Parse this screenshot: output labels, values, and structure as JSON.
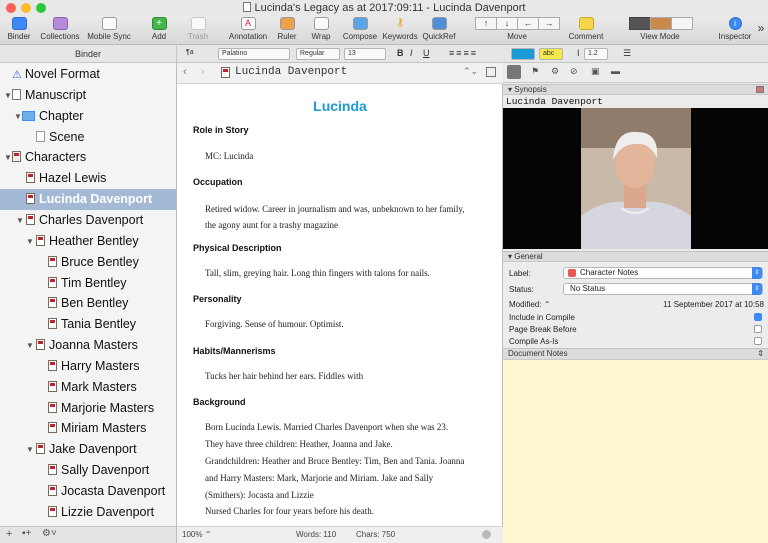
{
  "window": {
    "title": "Lucinda's Legacy as at 2017:09:11 - Lucinda Davenport"
  },
  "toolbar": {
    "binder": "Binder",
    "collections": "Collections",
    "mobile_sync": "Mobile Sync",
    "add": "Add",
    "trash": "Trash",
    "annotation": "Annotation",
    "ruler": "Ruler",
    "wrap": "Wrap",
    "compose": "Compose",
    "keywords": "Keywords",
    "quickref": "QuickRef",
    "move": "Move",
    "comment": "Comment",
    "view_mode": "View Mode",
    "inspector": "Inspector",
    "overflow": "»"
  },
  "formatbar": {
    "binder_label": "Binder",
    "style_icon": "¶a",
    "font": "Palatino",
    "weight": "Regular",
    "size": "13",
    "bold": "B",
    "italic": "I",
    "underline": "U",
    "highlight": "abc",
    "line_spacing": "1.2"
  },
  "binder": {
    "items": [
      {
        "label": "Novel Format",
        "icon": "warning-icon",
        "selected": false
      },
      {
        "label": "Manuscript",
        "icon": "manuscript-icon",
        "selected": false
      },
      {
        "label": "Chapter",
        "icon": "folder-icon",
        "selected": false
      },
      {
        "label": "Scene",
        "icon": "document-icon",
        "selected": false
      },
      {
        "label": "Characters",
        "icon": "character-folder-icon",
        "selected": false
      },
      {
        "label": "Hazel Lewis",
        "icon": "character-sheet-icon",
        "selected": false
      },
      {
        "label": "Lucinda Davenport",
        "icon": "character-sheet-icon",
        "selected": true
      },
      {
        "label": "Charles Davenport",
        "icon": "character-sheet-icon",
        "selected": false
      },
      {
        "label": "Heather Bentley",
        "icon": "character-sheet-icon",
        "selected": false
      },
      {
        "label": "Bruce Bentley",
        "icon": "character-sheet-icon",
        "selected": false
      },
      {
        "label": "Tim Bentley",
        "icon": "character-sheet-icon",
        "selected": false
      },
      {
        "label": "Ben Bentley",
        "icon": "character-sheet-icon",
        "selected": false
      },
      {
        "label": "Tania Bentley",
        "icon": "character-sheet-icon",
        "selected": false
      },
      {
        "label": "Joanna Masters",
        "icon": "character-sheet-icon",
        "selected": false
      },
      {
        "label": "Harry Masters",
        "icon": "character-sheet-icon",
        "selected": false
      },
      {
        "label": "Mark Masters",
        "icon": "character-sheet-icon",
        "selected": false
      },
      {
        "label": "Marjorie Masters",
        "icon": "character-sheet-icon",
        "selected": false
      },
      {
        "label": "Miriam Masters",
        "icon": "character-sheet-icon",
        "selected": false
      },
      {
        "label": "Jake Davenport",
        "icon": "character-sheet-icon",
        "selected": false
      },
      {
        "label": "Sally Davenport",
        "icon": "character-sheet-icon",
        "selected": false
      },
      {
        "label": "Jocasta Davenport",
        "icon": "character-sheet-icon",
        "selected": false
      },
      {
        "label": "Lizzie Davenport",
        "icon": "character-sheet-icon",
        "selected": false
      }
    ]
  },
  "editor": {
    "header_title": "Lucinda Davenport",
    "doc_title": "Lucinda",
    "sections": [
      {
        "heading": "Role in Story",
        "body": [
          "MC: Lucinda"
        ]
      },
      {
        "heading": "Occupation",
        "body": [
          "Retired widow. Career in journalism and was, unbeknown to her family,",
          "the agony aunt for a trashy magazine"
        ]
      },
      {
        "heading": "Physical Description",
        "body": [
          "Tall, slim, greying hair.  Long thin fingers with talons for nails."
        ]
      },
      {
        "heading": "Personality",
        "body": [
          "Forgiving. Sense of humour. Optimist."
        ]
      },
      {
        "heading": "Habits/Mannerisms",
        "body": [
          "Tucks her hair behind her ears. Fiddles with"
        ]
      },
      {
        "heading": "Background",
        "body": [
          "Born Lucinda Lewis. Married Charles Davenport when she was 23.",
          "They have three children: Heather, Joanna and Jake.",
          "Grandchildren: Heather and  Bruce Bentley: Tim, Ben and Tania. Joanna",
          "and Harry Masters: Mark, Marjorie and Miriam. Jake and Sally",
          "(Smithers): Jocasta and Lizzie",
          "Nursed Charles for four years before his death."
        ]
      }
    ],
    "footer": {
      "zoom": "100%",
      "words": "Words: 110",
      "chars": "Chars: 750"
    }
  },
  "inspector": {
    "synopsis_header": "Synopsis",
    "synopsis_title": "Lucinda Davenport",
    "general_header": "General",
    "label_label": "Label:",
    "label_value": "Character Notes",
    "label_color": "#e8565a",
    "status_label": "Status:",
    "status_value": "No Status",
    "modified_label": "Modified:",
    "modified_value": "11 September 2017 at 10:58",
    "include_compile": "Include in Compile",
    "include_compile_checked": true,
    "page_break": "Page Break Before",
    "page_break_checked": false,
    "compile_as_is": "Compile As-Is",
    "compile_as_is_checked": false,
    "notes_header": "Document Notes"
  },
  "colors": {
    "accent": "#3d89f5",
    "selection": "#a4b9d6",
    "title_blue": "#1a9ad6",
    "notes_bg": "#fdf6cf"
  }
}
